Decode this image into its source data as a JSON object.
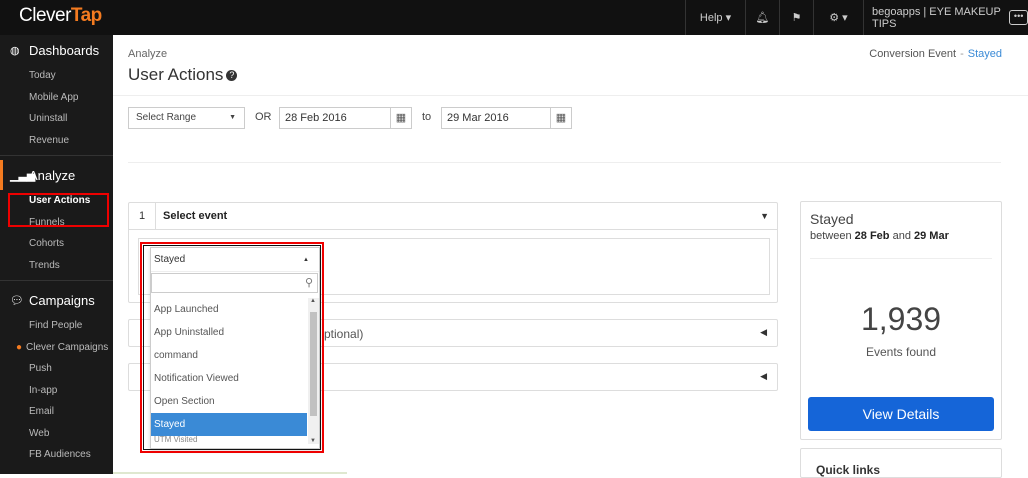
{
  "topbar": {
    "logo_a": "Clever",
    "logo_b": "Tap",
    "help_label": "Help ▾",
    "account_label": "begoapps | EYE MAKEUP TIPS"
  },
  "sidebar": {
    "dashboards": {
      "label": "Dashboards",
      "items": [
        "Today",
        "Mobile App",
        "Uninstall",
        "Revenue"
      ]
    },
    "analyze": {
      "label": "Analyze",
      "items": [
        "User Actions",
        "Funnels",
        "Cohorts",
        "Trends"
      ]
    },
    "campaigns": {
      "label": "Campaigns",
      "items": [
        "Find People",
        "Clever Campaigns",
        "Push",
        "In-app",
        "Email",
        "Web",
        "FB Audiences"
      ]
    }
  },
  "page": {
    "breadcrumb": "Analyze",
    "title": "User Actions",
    "conv_event": "Conversion Event",
    "conv_sep": "-",
    "conv_value": "Stayed"
  },
  "filters": {
    "range_label": "Select Range",
    "or_label": "OR",
    "date_from": "28 Feb 2016",
    "to_label": "to",
    "date_to": "29 Mar 2016"
  },
  "event_panel": {
    "step": "1",
    "title": "Select event",
    "optional_text": "ptional)",
    "dropdown": {
      "selected": "Stayed",
      "search_placeholder": "",
      "options": [
        "App Launched",
        "App Uninstalled",
        "command",
        "Notification Viewed",
        "Open Section",
        "Stayed",
        "UTM Visited"
      ]
    }
  },
  "stats": {
    "title": "Stayed",
    "between": "between",
    "from": "28 Feb",
    "and": "and",
    "to": "29 Mar",
    "count": "1,939",
    "count_label": "Events found",
    "button": "View Details"
  },
  "quick_links": "Quick links",
  "colors": {
    "accent": "#f47b20",
    "primary": "#1565d8",
    "highlight": "#3a8ad6",
    "annotation": "#e00000"
  }
}
